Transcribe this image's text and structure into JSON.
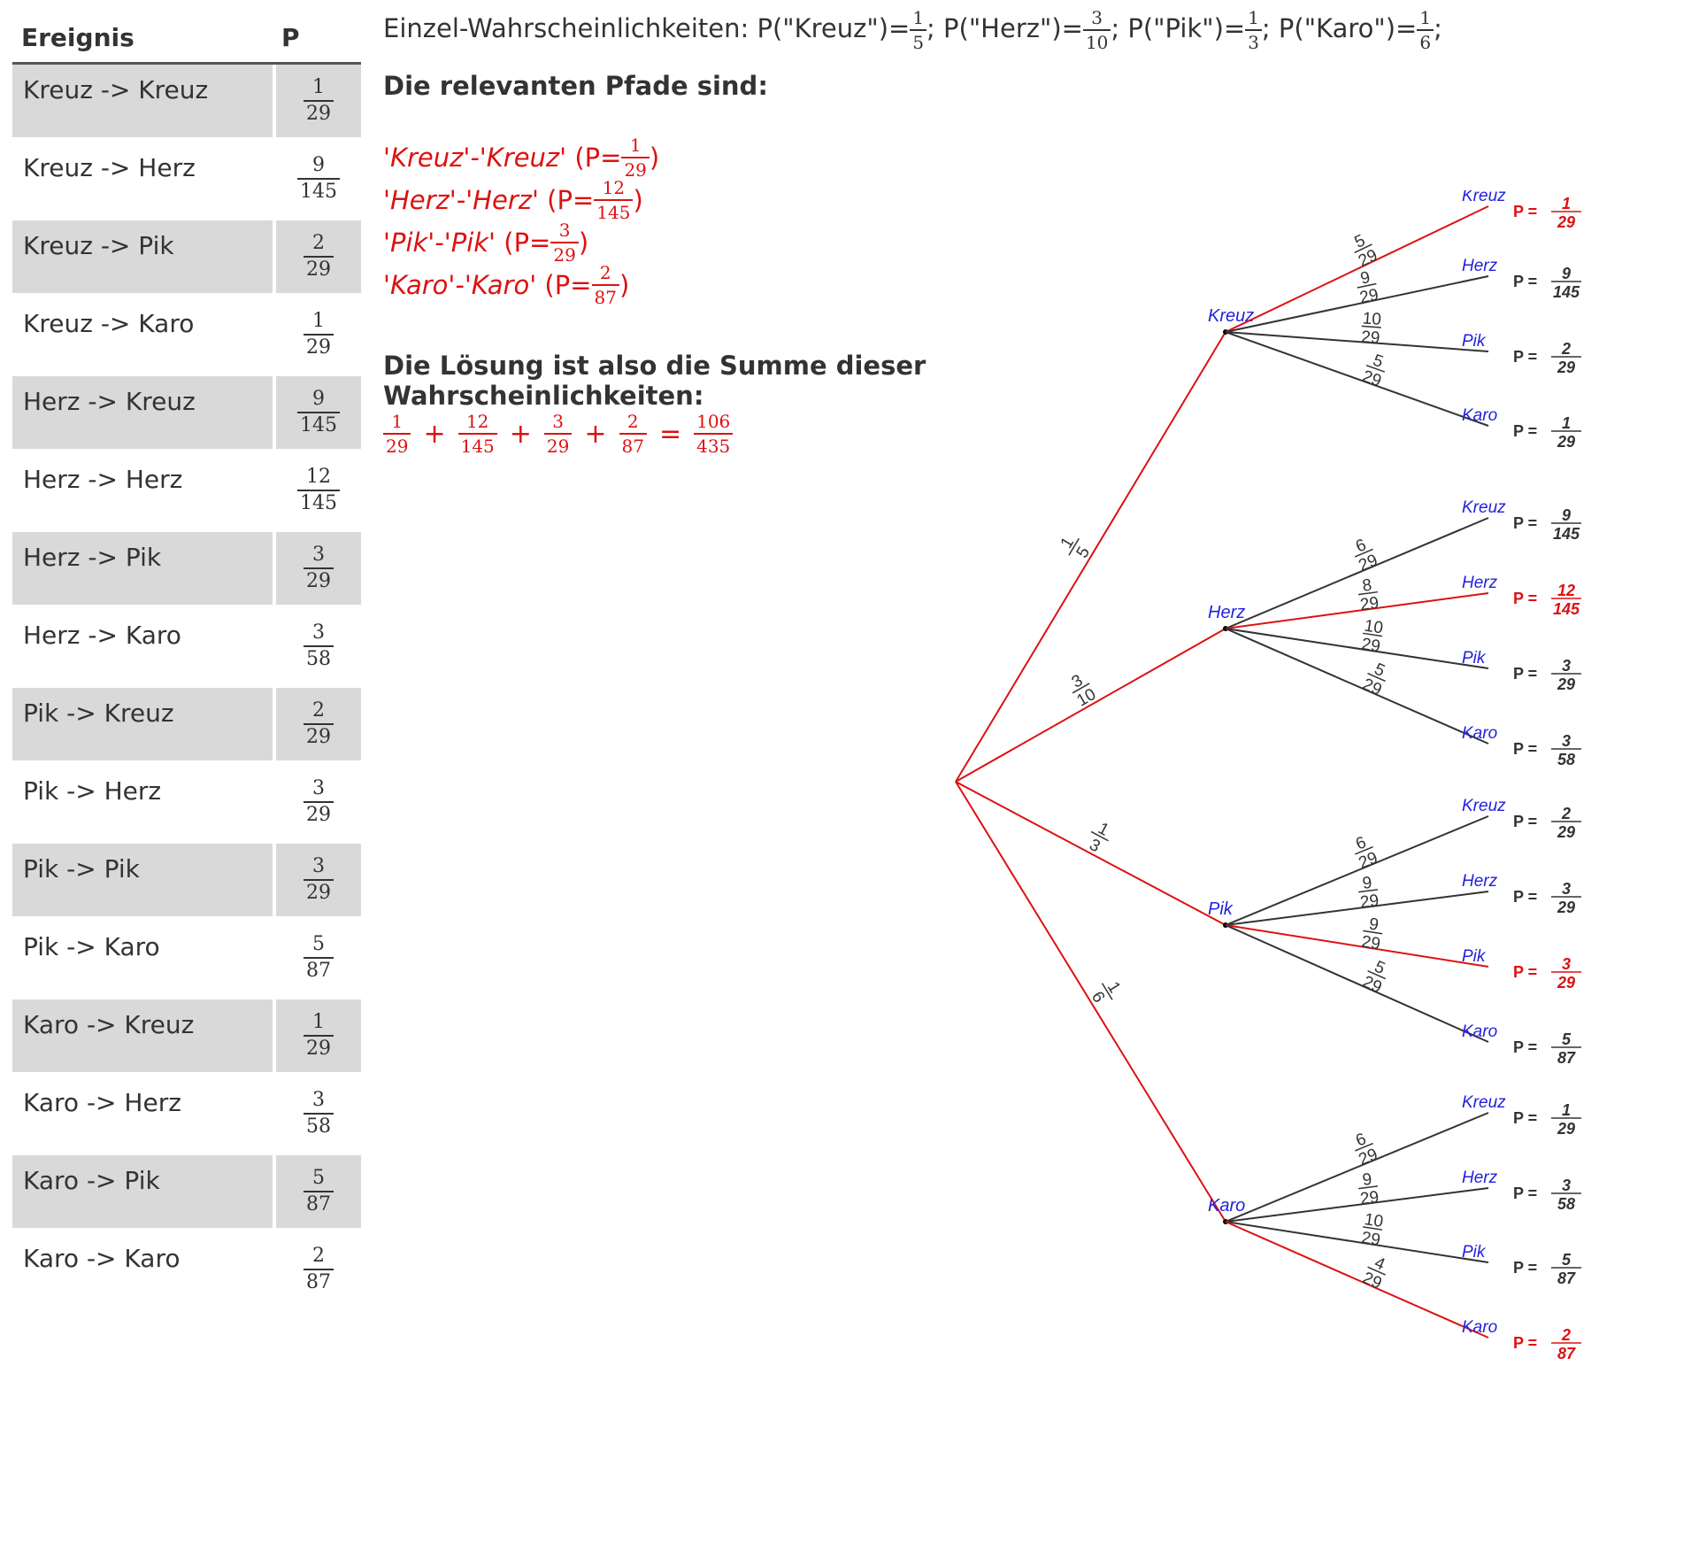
{
  "table": {
    "headers": [
      "Ereignis",
      "P"
    ],
    "rows": [
      {
        "event": "Kreuz -> Kreuz",
        "num": "1",
        "den": "29",
        "shaded": true
      },
      {
        "event": "Kreuz -> Herz",
        "num": "9",
        "den": "145",
        "shaded": false
      },
      {
        "event": "Kreuz -> Pik",
        "num": "2",
        "den": "29",
        "shaded": true
      },
      {
        "event": "Kreuz -> Karo",
        "num": "1",
        "den": "29",
        "shaded": false
      },
      {
        "event": "Herz -> Kreuz",
        "num": "9",
        "den": "145",
        "shaded": true
      },
      {
        "event": "Herz -> Herz",
        "num": "12",
        "den": "145",
        "shaded": false
      },
      {
        "event": "Herz -> Pik",
        "num": "3",
        "den": "29",
        "shaded": true
      },
      {
        "event": "Herz -> Karo",
        "num": "3",
        "den": "58",
        "shaded": false
      },
      {
        "event": "Pik -> Kreuz",
        "num": "2",
        "den": "29",
        "shaded": true
      },
      {
        "event": "Pik -> Herz",
        "num": "3",
        "den": "29",
        "shaded": false
      },
      {
        "event": "Pik -> Pik",
        "num": "3",
        "den": "29",
        "shaded": true
      },
      {
        "event": "Pik -> Karo",
        "num": "5",
        "den": "87",
        "shaded": false
      },
      {
        "event": "Karo -> Kreuz",
        "num": "1",
        "den": "29",
        "shaded": true
      },
      {
        "event": "Karo -> Herz",
        "num": "3",
        "den": "58",
        "shaded": false
      },
      {
        "event": "Karo -> Pik",
        "num": "5",
        "den": "87",
        "shaded": true
      },
      {
        "event": "Karo -> Karo",
        "num": "2",
        "den": "87",
        "shaded": false
      }
    ]
  },
  "intro": {
    "prefix": "Einzel-Wahrscheinlichkeiten:",
    "items": [
      {
        "label": "P(\"Kreuz\")=",
        "num": "1",
        "den": "5",
        "sep": ";"
      },
      {
        "label": "P(\"Herz\")=",
        "num": "3",
        "den": "10",
        "sep": ";"
      },
      {
        "label": "P(\"Pik\")=",
        "num": "1",
        "den": "3",
        "sep": ";"
      },
      {
        "label": "P(\"Karo\")=",
        "num": "1",
        "den": "6",
        "sep": ";"
      }
    ]
  },
  "paths_heading": "Die relevanten Pfade sind:",
  "paths": [
    {
      "name": "'Kreuz'-'Kreuz'",
      "prefix": "(P=",
      "num": "1",
      "den": "29",
      "suffix": ")"
    },
    {
      "name": "'Herz'-'Herz'",
      "prefix": "(P=",
      "num": "12",
      "den": "145",
      "suffix": ")"
    },
    {
      "name": "'Pik'-'Pik'",
      "prefix": "(P=",
      "num": "3",
      "den": "29",
      "suffix": ")"
    },
    {
      "name": "'Karo'-'Karo'",
      "prefix": "(P=",
      "num": "2",
      "den": "87",
      "suffix": ")"
    }
  ],
  "solution_heading_1": "Die Lösung ist also die Summe dieser",
  "solution_heading_2": "Wahrscheinlichkeiten:",
  "sum": {
    "terms": [
      {
        "num": "1",
        "den": "29"
      },
      {
        "num": "12",
        "den": "145"
      },
      {
        "num": "3",
        "den": "29"
      },
      {
        "num": "2",
        "den": "87"
      }
    ],
    "plus": "+",
    "equals": "=",
    "result": {
      "num": "106",
      "den": "435"
    }
  },
  "tree": {
    "colors": {
      "highlight": "#dd1111",
      "line": "#333333",
      "label": "#2222dd"
    },
    "p_prefix": "P =",
    "first_stage": [
      {
        "label": "Kreuz",
        "num": "1",
        "den": "5",
        "highlight": true
      },
      {
        "label": "Herz",
        "num": "3",
        "den": "10",
        "highlight": true
      },
      {
        "label": "Pik",
        "num": "1",
        "den": "3",
        "highlight": true
      },
      {
        "label": "Karo",
        "num": "1",
        "den": "6",
        "highlight": true
      }
    ],
    "second_stage": [
      [
        {
          "label": "Kreuz",
          "num": "5",
          "den": "29",
          "pnum": "1",
          "pden": "29",
          "highlight": true
        },
        {
          "label": "Herz",
          "num": "9",
          "den": "29",
          "pnum": "9",
          "pden": "145",
          "highlight": false
        },
        {
          "label": "Pik",
          "num": "10",
          "den": "29",
          "pnum": "2",
          "pden": "29",
          "highlight": false
        },
        {
          "label": "Karo",
          "num": "5",
          "den": "29",
          "pnum": "1",
          "pden": "29",
          "highlight": false
        }
      ],
      [
        {
          "label": "Kreuz",
          "num": "6",
          "den": "29",
          "pnum": "9",
          "pden": "145",
          "highlight": false
        },
        {
          "label": "Herz",
          "num": "8",
          "den": "29",
          "pnum": "12",
          "pden": "145",
          "highlight": true
        },
        {
          "label": "Pik",
          "num": "10",
          "den": "29",
          "pnum": "3",
          "pden": "29",
          "highlight": false
        },
        {
          "label": "Karo",
          "num": "5",
          "den": "29",
          "pnum": "3",
          "pden": "58",
          "highlight": false
        }
      ],
      [
        {
          "label": "Kreuz",
          "num": "6",
          "den": "29",
          "pnum": "2",
          "pden": "29",
          "highlight": false
        },
        {
          "label": "Herz",
          "num": "9",
          "den": "29",
          "pnum": "3",
          "pden": "29",
          "highlight": false
        },
        {
          "label": "Pik",
          "num": "9",
          "den": "29",
          "pnum": "3",
          "pden": "29",
          "highlight": true
        },
        {
          "label": "Karo",
          "num": "5",
          "den": "29",
          "pnum": "5",
          "pden": "87",
          "highlight": false
        }
      ],
      [
        {
          "label": "Kreuz",
          "num": "6",
          "den": "29",
          "pnum": "1",
          "pden": "29",
          "highlight": false
        },
        {
          "label": "Herz",
          "num": "9",
          "den": "29",
          "pnum": "3",
          "pden": "58",
          "highlight": false
        },
        {
          "label": "Pik",
          "num": "10",
          "den": "29",
          "pnum": "5",
          "pden": "87",
          "highlight": false
        },
        {
          "label": "Karo",
          "num": "4",
          "den": "29",
          "pnum": "2",
          "pden": "87",
          "highlight": true
        }
      ]
    ]
  }
}
